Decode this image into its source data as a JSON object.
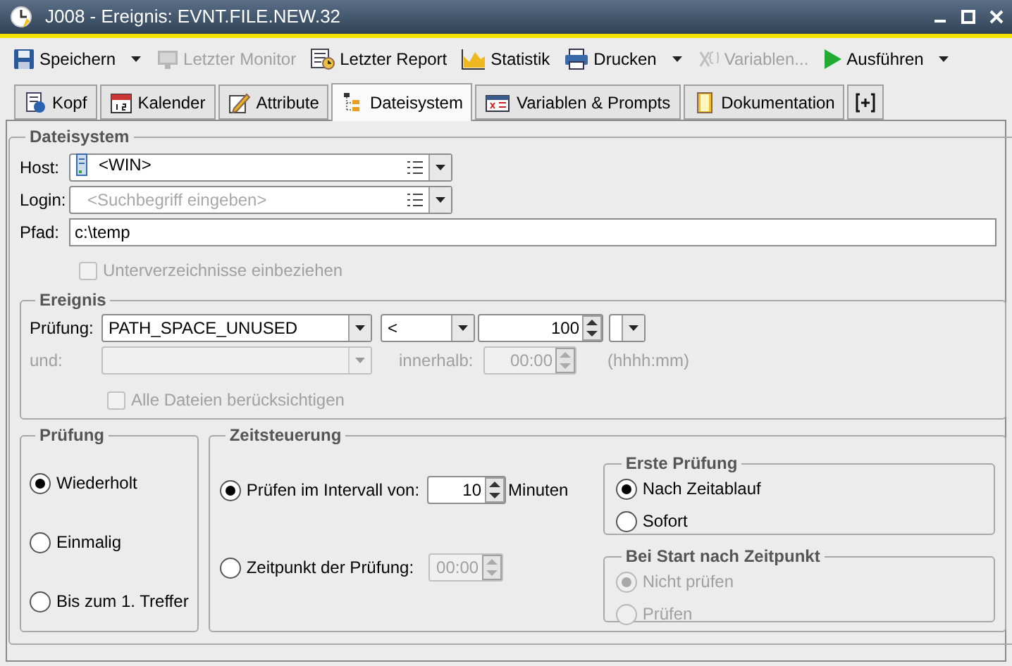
{
  "window": {
    "title": "J008 - Ereignis: EVNT.FILE.NEW.32"
  },
  "toolbar": [
    {
      "kind": "save",
      "label": "Speichern",
      "disabled": false,
      "menu": true
    },
    {
      "kind": "monitor",
      "label": "Letzter Monitor",
      "disabled": true,
      "menu": false
    },
    {
      "kind": "report",
      "label": "Letzter Report",
      "disabled": false,
      "menu": false
    },
    {
      "kind": "chart",
      "label": "Statistik",
      "disabled": false,
      "menu": false
    },
    {
      "kind": "print",
      "label": "Drucken",
      "disabled": false,
      "menu": true
    },
    {
      "kind": "variables",
      "label": "Variablen...",
      "disabled": true,
      "menu": false
    },
    {
      "kind": "run",
      "label": "Ausführen",
      "disabled": false,
      "menu": true
    }
  ],
  "tabs": [
    {
      "kind": "head",
      "label": "Kopf",
      "selected": false
    },
    {
      "kind": "calendar",
      "label": "Kalender",
      "selected": false
    },
    {
      "kind": "attributes",
      "label": "Attribute",
      "selected": false
    },
    {
      "kind": "tree",
      "label": "Dateisystem",
      "selected": true
    },
    {
      "kind": "variables",
      "label": "Variablen & Prompts",
      "selected": false
    },
    {
      "kind": "docs",
      "label": "Dokumentation",
      "selected": false
    },
    {
      "kind": "add",
      "selected": false
    }
  ],
  "dateisystem": {
    "title": "Dateisystem",
    "host": {
      "label": "Host:",
      "value": "<WIN>"
    },
    "login": {
      "label": "Login:",
      "placeholder": "<Suchbegriff eingeben>"
    },
    "pfad": {
      "label": "Pfad:",
      "value": "c:\\temp"
    },
    "subdirs": {
      "label": "Unterverzeichnisse einbeziehen",
      "checked": false,
      "disabled": true
    },
    "ereignis": {
      "title": "Ereignis",
      "pruefung": {
        "label": "Prüfung:",
        "value": "PATH_SPACE_UNUSED",
        "operator": "<",
        "amount": "100"
      },
      "und": {
        "label": "und:",
        "disabled": true
      },
      "innerhalb": {
        "label": "innerhalb:",
        "value": "00:00",
        "hint": "(hhhh:mm)",
        "disabled": true
      },
      "alle_dateien": {
        "label": "Alle Dateien berücksichtigen",
        "checked": false,
        "disabled": true
      }
    },
    "pruefung_mode": {
      "title": "Prüfung",
      "options": [
        {
          "label": "Wiederholt",
          "selected": true
        },
        {
          "label": "Einmalig",
          "selected": false
        },
        {
          "label": "Bis zum 1. Treffer",
          "selected": false
        }
      ]
    },
    "zeitsteuerung": {
      "title": "Zeitsteuerung",
      "interval": {
        "label": "Prüfen im Intervall von:",
        "selected": true,
        "value": "10",
        "unit": "Minuten"
      },
      "zeitpunkt": {
        "label": "Zeitpunkt der Prüfung:",
        "selected": false,
        "value": "00:00",
        "disabled": true
      },
      "erste_pruefung": {
        "title": "Erste Prüfung",
        "disabled": false,
        "options": [
          {
            "label": "Nach Zeitablauf",
            "selected": true
          },
          {
            "label": "Sofort",
            "selected": false
          }
        ]
      },
      "bei_start": {
        "title": "Bei Start nach Zeitpunkt",
        "disabled": true,
        "options": [
          {
            "label": "Nicht prüfen",
            "selected": true
          },
          {
            "label": "Prüfen",
            "selected": false
          }
        ]
      }
    }
  }
}
